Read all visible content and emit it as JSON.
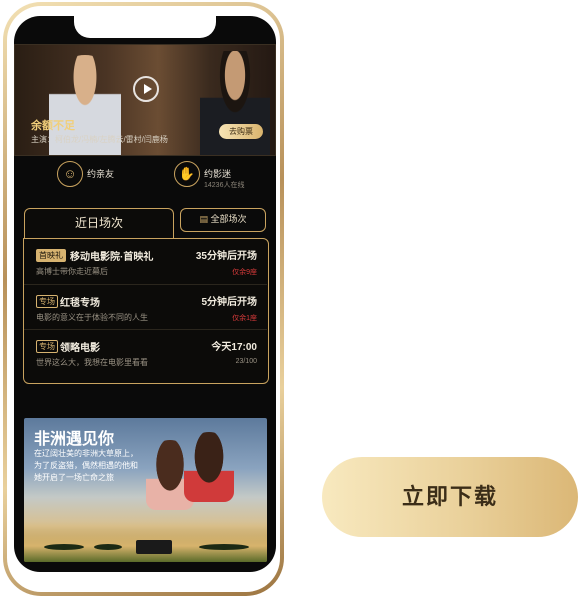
{
  "hero": {
    "title": "余额不足",
    "cast": "主演：柯伯龙/冯楠/左腾云/雷村/闫鹿杨",
    "buy_label": "去购票",
    "play_icon": "play-icon"
  },
  "actions": [
    {
      "label": "约亲友",
      "sub": "",
      "icon": "friends-icon"
    },
    {
      "label": "约影迷",
      "sub": "14236人在线",
      "icon": "fans-icon"
    }
  ],
  "schedule": {
    "tab_title": "近日场次",
    "all_label": "全部场次",
    "items": [
      {
        "tag": "首映礼",
        "name": "移动电影院·首映礼",
        "desc": "高博士带你走近幕后",
        "time": "35分钟后开场",
        "seats": "仅余9座"
      },
      {
        "tag": "专场",
        "name": "红毯专场",
        "desc": "电影的意义在于体验不同的人生",
        "time": "5分钟后开场",
        "seats": "仅余1座"
      },
      {
        "tag": "专场",
        "name": "领略电影",
        "desc": "世界这么大，我想在电影里看看",
        "time": "今天17:00",
        "seats": "23/100"
      }
    ]
  },
  "promo": {
    "title": "非洲遇见你",
    "text": "在辽阔壮美的非洲大草原上，为了反盗猎，偶然相遇的他和她开启了一场亡命之旅"
  },
  "download": {
    "label": "立即下载"
  },
  "colors": {
    "gold": "#c9a35f",
    "accent_red": "#d63a3a",
    "button_gradient_start": "#f8e9bf",
    "button_gradient_end": "#dbb776"
  }
}
